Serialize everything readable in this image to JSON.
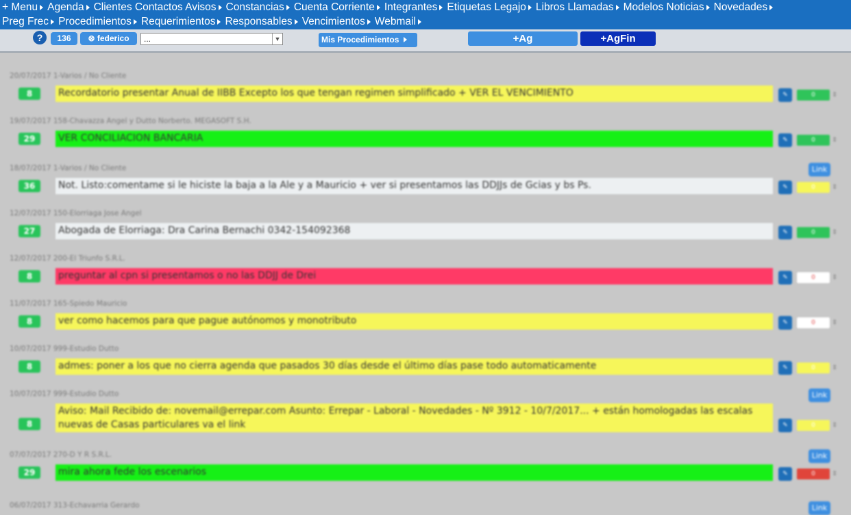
{
  "nav": {
    "row1": [
      "+ Menu",
      "Agenda",
      "Clientes Contactos Avisos",
      "Constancias",
      "Cuenta Corriente",
      "Integrantes",
      "Etiquetas Legajo",
      "Libros Llamadas",
      "Modelos Noticias",
      "Novedades"
    ],
    "row2": [
      "Preg Frec",
      "Procedimientos",
      "Requerimientos",
      "Responsables",
      "Vencimientos",
      "Webmail"
    ]
  },
  "toolbar": {
    "help_label": "?",
    "count_label": "136",
    "user_label": "⊗ federico",
    "select_value": "...",
    "mis_procedimientos_label": "Mis Procedimientos",
    "ag_label": "+Ag",
    "agfin_label": "+AgFin"
  },
  "colors": {
    "yellow": "#f6f65a",
    "green": "#16f016",
    "light": "#edf0f2",
    "red": "#ff3a66"
  },
  "entries": [
    {
      "meta": "20/07/2017 1-Varios / No Cliente",
      "days": "8",
      "text": "Recordatorio presentar Anual de IIBB Excepto los que tengan regimen simplificado + VER EL VENCIMIENTO",
      "color": "yellow",
      "counter_color": "#2fc45a",
      "link": false
    },
    {
      "meta": "19/07/2017 158-Chavazza Angel y Dutto Norberto. MEGASOFT S.H.",
      "days": "29",
      "text": "VER CONCILIACION BANCARIA",
      "color": "green",
      "counter_color": "#2fc45a",
      "link": false
    },
    {
      "meta": "18/07/2017 1-Varios / No Cliente",
      "days": "36",
      "text": "Not. Listo:comentame si le hiciste la baja a la Ale y a Mauricio + ver si presentamos las DDJJs de Gcias y bs Ps.",
      "color": "light",
      "counter_color": "#f6f65a",
      "link": true,
      "link_label": "Link"
    },
    {
      "meta": "12/07/2017 150-Elorriaga Jose Angel",
      "days": "27",
      "text": "Abogada de Elorriaga: Dra Carina Bernachi 0342-154092368",
      "color": "light",
      "counter_color": "#2fc45a",
      "link": false
    },
    {
      "meta": "12/07/2017 200-El Triunfo S.R.L.",
      "days": "8",
      "text": "preguntar al cpn si presentamos o no las DDJJ de Drei",
      "color": "red",
      "counter_color": "#ffffff",
      "link": false
    },
    {
      "meta": "11/07/2017 165-Spiedo Mauricio",
      "days": "8",
      "text": "ver como hacemos para que pague autónomos y monotributo",
      "color": "yellow",
      "counter_color": "#ffffff",
      "link": false
    },
    {
      "meta": "10/07/2017 999-Estudio Dutto",
      "days": "8",
      "text": "admes: poner a los que no cierra agenda que pasados 30 días desde el último días pase todo automaticamente",
      "color": "yellow",
      "counter_color": "#f6f65a",
      "link": false
    },
    {
      "meta": "10/07/2017 999-Estudio Dutto",
      "days": "8",
      "text": "Aviso: Mail Recibido de: novemail@errepar.com Asunto: Errepar - Laboral - Novedades - Nº 3912 - 10/7/2017... + están homologadas las escalas nuevas de Casas particulares va el link",
      "color": "yellow",
      "counter_color": "#f6f65a",
      "link": true,
      "link_label": "Link"
    },
    {
      "meta": "07/07/2017 270-D Y R S.R.L.",
      "days": "29",
      "text": "mira ahora fede los escenarios",
      "color": "green",
      "counter_color": "#e0443a",
      "link": true,
      "link_label": "Link"
    },
    {
      "meta": "06/07/2017 313-Echavarria Gerardo",
      "days": "",
      "text": "",
      "color": "light",
      "counter_color": "#ffffff",
      "link": true,
      "link_label": "Link"
    }
  ]
}
